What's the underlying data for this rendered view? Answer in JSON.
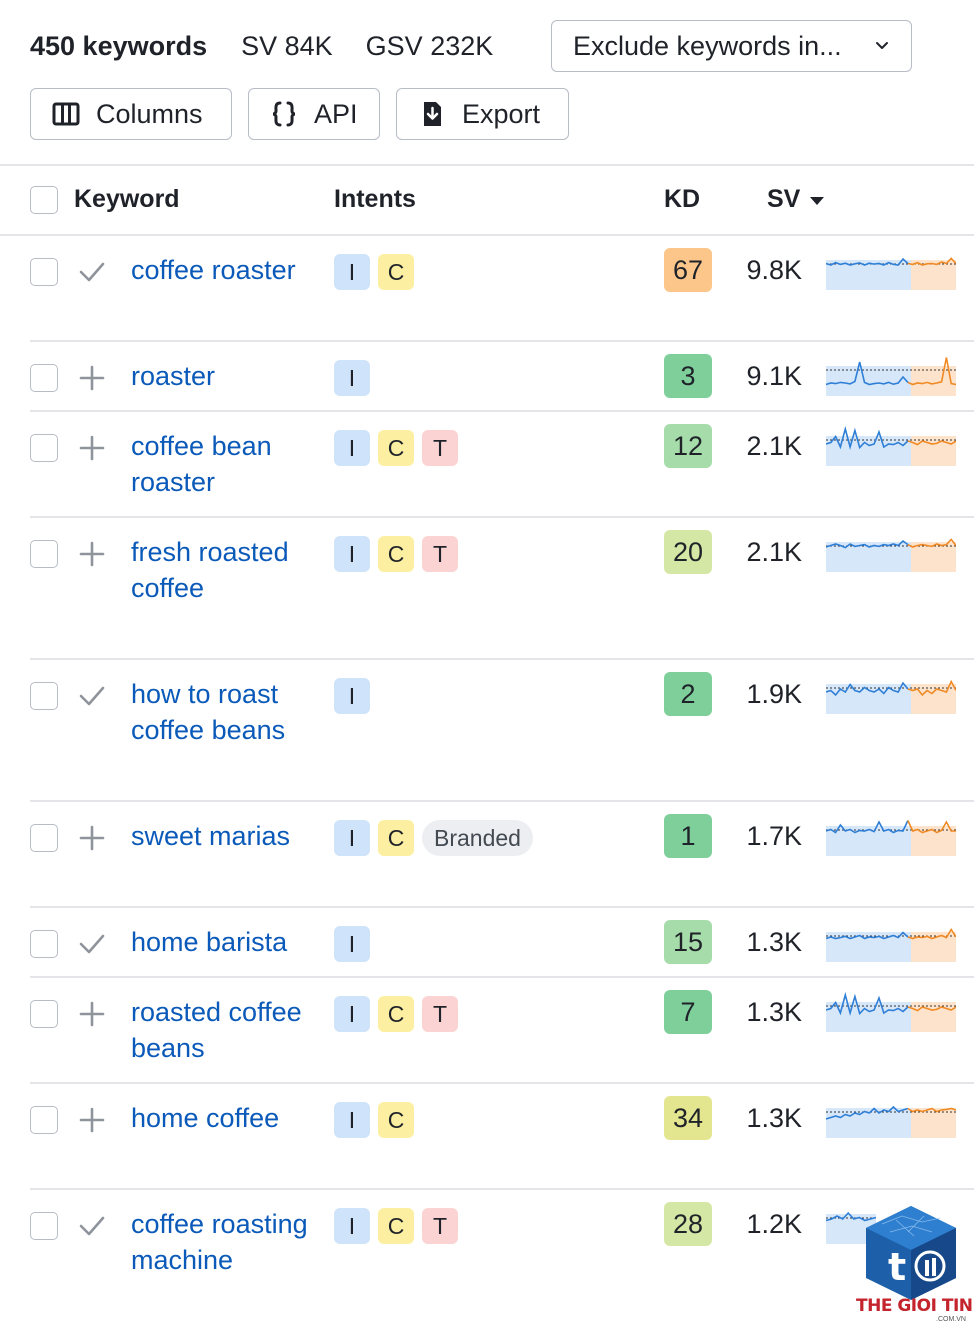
{
  "summary": {
    "keyword_count": "450 keywords",
    "sv": "SV 84K",
    "gsv": "GSV 232K"
  },
  "filter": {
    "exclude_label": "Exclude keywords in..."
  },
  "toolbar": {
    "columns_label": "Columns",
    "api_label": "API",
    "export_label": "Export"
  },
  "table": {
    "headers": {
      "keyword": "Keyword",
      "intents": "Intents",
      "kd": "KD",
      "sv": "SV"
    },
    "rows": [
      {
        "keyword": "coffee roaster",
        "status": "check",
        "intents": [
          "I",
          "C"
        ],
        "branded": "",
        "kd": "67",
        "kd_color": "#fcc58a",
        "sv": "9.8K"
      },
      {
        "keyword": "roaster",
        "status": "plus",
        "intents": [
          "I"
        ],
        "branded": "",
        "kd": "3",
        "kd_color": "#7fcf9a",
        "sv": "9.1K"
      },
      {
        "keyword": "coffee bean roaster",
        "status": "plus",
        "intents": [
          "I",
          "C",
          "T"
        ],
        "branded": "",
        "kd": "12",
        "kd_color": "#a6dcaa",
        "sv": "2.1K"
      },
      {
        "keyword": "fresh roasted coffee",
        "status": "plus",
        "intents": [
          "I",
          "C",
          "T"
        ],
        "branded": "",
        "kd": "20",
        "kd_color": "#d5e7a4",
        "sv": "2.1K"
      },
      {
        "keyword": "how to roast coffee beans",
        "status": "check",
        "intents": [
          "I"
        ],
        "branded": "",
        "kd": "2",
        "kd_color": "#7fcf9a",
        "sv": "1.9K"
      },
      {
        "keyword": "sweet marias",
        "status": "plus",
        "intents": [
          "I",
          "C"
        ],
        "branded": "Branded",
        "kd": "1",
        "kd_color": "#7fcf9a",
        "sv": "1.7K"
      },
      {
        "keyword": "home barista",
        "status": "check",
        "intents": [
          "I"
        ],
        "branded": "",
        "kd": "15",
        "kd_color": "#a6dcaa",
        "sv": "1.3K"
      },
      {
        "keyword": "roasted coffee beans",
        "status": "plus",
        "intents": [
          "I",
          "C",
          "T"
        ],
        "branded": "",
        "kd": "7",
        "kd_color": "#7fcf9a",
        "sv": "1.3K"
      },
      {
        "keyword": "home coffee",
        "status": "plus",
        "intents": [
          "I",
          "C"
        ],
        "branded": "",
        "kd": "34",
        "kd_color": "#e4e58f",
        "sv": "1.3K"
      },
      {
        "keyword": "coffee roasting machine",
        "status": "check",
        "intents": [
          "I",
          "C",
          "T"
        ],
        "branded": "",
        "kd": "28",
        "kd_color": "#d5e7a4",
        "sv": "1.2K"
      }
    ]
  },
  "sparklines": [
    [
      0.45,
      0.5,
      0.42,
      0.48,
      0.44,
      0.5,
      0.46,
      0.43,
      0.5,
      0.44,
      0.47,
      0.45,
      0.5,
      0.42,
      0.48,
      0.5,
      0.3,
      0.45,
      0.48,
      0.42,
      0.5,
      0.46,
      0.45,
      0.48,
      0.4,
      0.45,
      0.28,
      0.45
    ],
    [
      0.95,
      0.9,
      0.92,
      0.88,
      0.9,
      0.93,
      0.85,
      0.2,
      0.88,
      0.95,
      0.92,
      0.9,
      0.93,
      0.88,
      0.94,
      0.9,
      0.7,
      0.88,
      0.95,
      0.9,
      0.92,
      0.88,
      0.93,
      0.9,
      0.86,
      0.05,
      0.92,
      0.95
    ],
    [
      0.6,
      0.55,
      0.35,
      0.7,
      0.1,
      0.7,
      0.15,
      0.72,
      0.55,
      0.65,
      0.6,
      0.2,
      0.7,
      0.6,
      0.62,
      0.55,
      0.65,
      0.5,
      0.55,
      0.62,
      0.5,
      0.55,
      0.6,
      0.58,
      0.5,
      0.55,
      0.6,
      0.5
    ],
    [
      0.5,
      0.45,
      0.4,
      0.45,
      0.52,
      0.4,
      0.48,
      0.45,
      0.42,
      0.5,
      0.45,
      0.48,
      0.42,
      0.45,
      0.4,
      0.45,
      0.3,
      0.42,
      0.5,
      0.45,
      0.42,
      0.45,
      0.48,
      0.4,
      0.45,
      0.42,
      0.25,
      0.45
    ],
    [
      0.6,
      0.55,
      0.7,
      0.5,
      0.6,
      0.35,
      0.55,
      0.6,
      0.45,
      0.55,
      0.6,
      0.5,
      0.65,
      0.45,
      0.55,
      0.6,
      0.3,
      0.5,
      0.55,
      0.5,
      0.7,
      0.55,
      0.65,
      0.5,
      0.55,
      0.6,
      0.25,
      0.55
    ],
    [
      0.5,
      0.45,
      0.55,
      0.3,
      0.5,
      0.45,
      0.55,
      0.48,
      0.5,
      0.45,
      0.52,
      0.2,
      0.5,
      0.45,
      0.55,
      0.48,
      0.5,
      0.15,
      0.5,
      0.45,
      0.55,
      0.5,
      0.45,
      0.55,
      0.48,
      0.2,
      0.5,
      0.5
    ],
    [
      0.55,
      0.5,
      0.55,
      0.52,
      0.48,
      0.55,
      0.5,
      0.45,
      0.55,
      0.5,
      0.52,
      0.48,
      0.55,
      0.5,
      0.45,
      0.52,
      0.35,
      0.5,
      0.55,
      0.5,
      0.52,
      0.48,
      0.55,
      0.5,
      0.45,
      0.52,
      0.25,
      0.5
    ],
    [
      0.6,
      0.55,
      0.35,
      0.7,
      0.1,
      0.7,
      0.15,
      0.72,
      0.55,
      0.65,
      0.6,
      0.2,
      0.7,
      0.6,
      0.62,
      0.55,
      0.65,
      0.5,
      0.55,
      0.62,
      0.5,
      0.55,
      0.6,
      0.58,
      0.5,
      0.55,
      0.6,
      0.5
    ],
    [
      0.7,
      0.65,
      0.6,
      0.65,
      0.55,
      0.6,
      0.5,
      0.55,
      0.45,
      0.5,
      0.35,
      0.5,
      0.4,
      0.45,
      0.3,
      0.45,
      0.4,
      0.35,
      0.45,
      0.4,
      0.45,
      0.4,
      0.35,
      0.45,
      0.4,
      0.38,
      0.35,
      0.4
    ],
    [
      0.55,
      0.5,
      0.4,
      0.5,
      0.3,
      0.5,
      0.45,
      0.55,
      0.5,
      0.45
    ]
  ],
  "colors": {
    "accent_link": "#0b5ab9",
    "spark_blue": "#2f7fd6",
    "spark_orange": "#f08a24",
    "spark_fill_blue": "#d6e7fa",
    "spark_fill_orange": "#fde3cc"
  },
  "icons": {
    "columns": "columns-icon",
    "api": "braces-icon",
    "export": "download-icon",
    "dropdown": "chevron-down-icon",
    "check": "check-icon",
    "plus": "plus-icon"
  },
  "watermark": {
    "brand_part1": "THE GIOI",
    "brand_part2": "TINHOC",
    "domain": ".COM.VN"
  }
}
